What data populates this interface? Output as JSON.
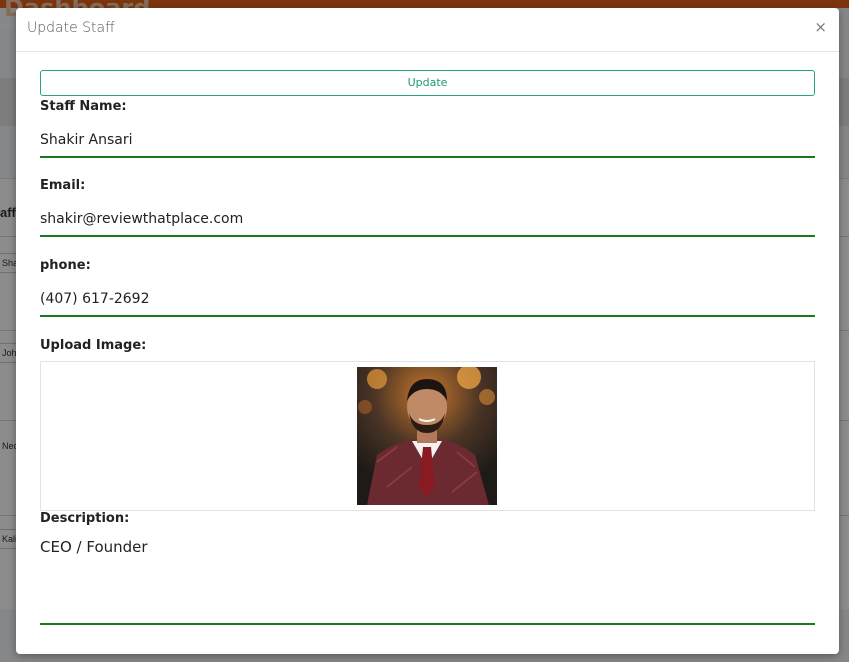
{
  "background": {
    "brand": "Dashboard",
    "sub": "ndo",
    "section_label": "aff",
    "rows": [
      "Shak",
      "John",
      "Ned",
      "Kalis"
    ]
  },
  "modal": {
    "title": "Update Staff",
    "close_label": "×",
    "update_button": "Update",
    "fields": {
      "staff_name": {
        "label": "Staff Name:",
        "value": "Shakir Ansari"
      },
      "email": {
        "label": "Email:",
        "value": "shakir@reviewthatplace.com"
      },
      "phone": {
        "label": "phone:",
        "value": "(407) 617-2692"
      },
      "upload": {
        "label": "Upload Image:"
      },
      "description": {
        "label": "Description:",
        "value": "CEO / Founder"
      }
    }
  },
  "colors": {
    "accent_green": "#1a7a1a",
    "button_teal": "#1a9c6c",
    "header_orange": "#e2611a"
  }
}
